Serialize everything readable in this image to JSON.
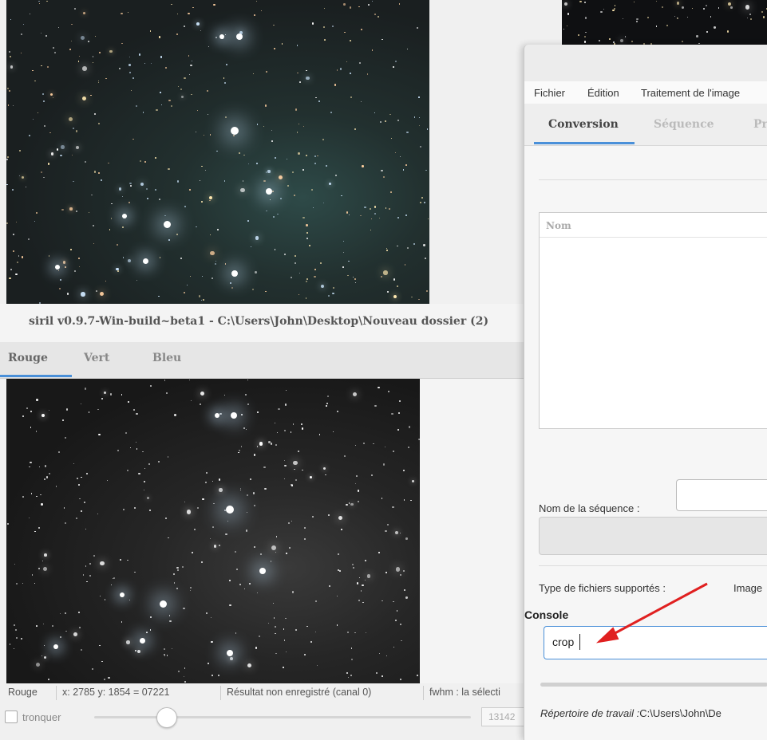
{
  "main_window": {
    "title": "siril v0.9.7-Win-build~beta1 - C:\\Users\\John\\Desktop\\Nouveau dossier (2)",
    "channel_tabs": [
      "Rouge",
      "Vert",
      "Bleu"
    ],
    "active_tab": "Rouge",
    "status": {
      "channel": "Rouge",
      "coords": "x: 2785 y: 1854 = 07221",
      "save_state": "Résultat non enregistré (canal 0)",
      "fwhm": "fwhm : la sélecti"
    },
    "truncate_label": "tronquer",
    "slider_value_text": "13142",
    "slider_level": 0.19
  },
  "conversion_dialog": {
    "menu": [
      "Fichier",
      "Édition",
      "Traitement de l'image"
    ],
    "tabs": [
      "Conversion",
      "Séquence",
      "Pr"
    ],
    "active_tab": "Conversion",
    "file_list_header": "Nom",
    "sequence_name_label": "Nom de la séquence :",
    "sequence_name_value": "",
    "supported_types_label": "Type de fichiers supportés :",
    "supported_types_value": "Image",
    "console_label": "Console",
    "console_input": "crop",
    "workdir_label": "Répertoire de travail :",
    "workdir_value": "C:\\Users\\John\\De"
  },
  "annotation": {
    "arrow_color": "#e02020"
  },
  "colors": {
    "accent": "#4a90d9",
    "sky_color": "#1c2224",
    "sky_mono": "#1f1f1f"
  }
}
